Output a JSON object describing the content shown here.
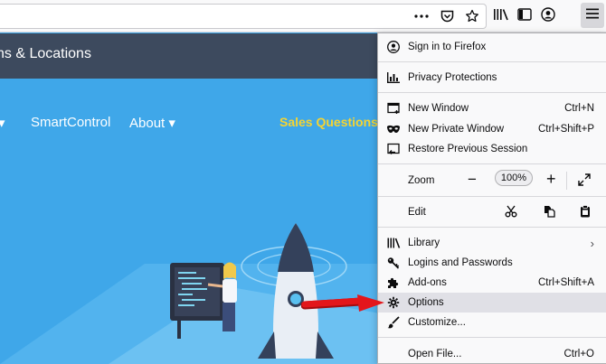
{
  "toolbar": {
    "page_actions": [
      "more-icon",
      "pocket-icon",
      "bookmark-star-icon"
    ],
    "right_icons": [
      "library-icon",
      "sidebar-icon",
      "account-icon",
      "hamburger-menu-icon"
    ]
  },
  "site": {
    "title": "ns & Locations",
    "nav": {
      "item1": "SmartControl",
      "item2": "About"
    },
    "sales": "Sales Questions?"
  },
  "menu": {
    "sign_in": "Sign in to Firefox",
    "privacy": "Privacy Protections",
    "new_window": {
      "label": "New Window",
      "shortcut": "Ctrl+N"
    },
    "new_private": {
      "label": "New Private Window",
      "shortcut": "Ctrl+Shift+P"
    },
    "restore": "Restore Previous Session",
    "zoom": {
      "label": "Zoom",
      "value": "100%"
    },
    "edit": "Edit",
    "library": "Library",
    "logins": "Logins and Passwords",
    "addons": {
      "label": "Add-ons",
      "shortcut": "Ctrl+Shift+A"
    },
    "options": "Options",
    "customize": "Customize...",
    "open_file": {
      "label": "Open File...",
      "shortcut": "Ctrl+O"
    }
  },
  "colors": {
    "site_blue": "#3fa7e9",
    "topbar": "#3d4a5e",
    "sales": "#f5d432",
    "arrow": "#e3161b",
    "menu_hover": "#e0e0e6"
  }
}
